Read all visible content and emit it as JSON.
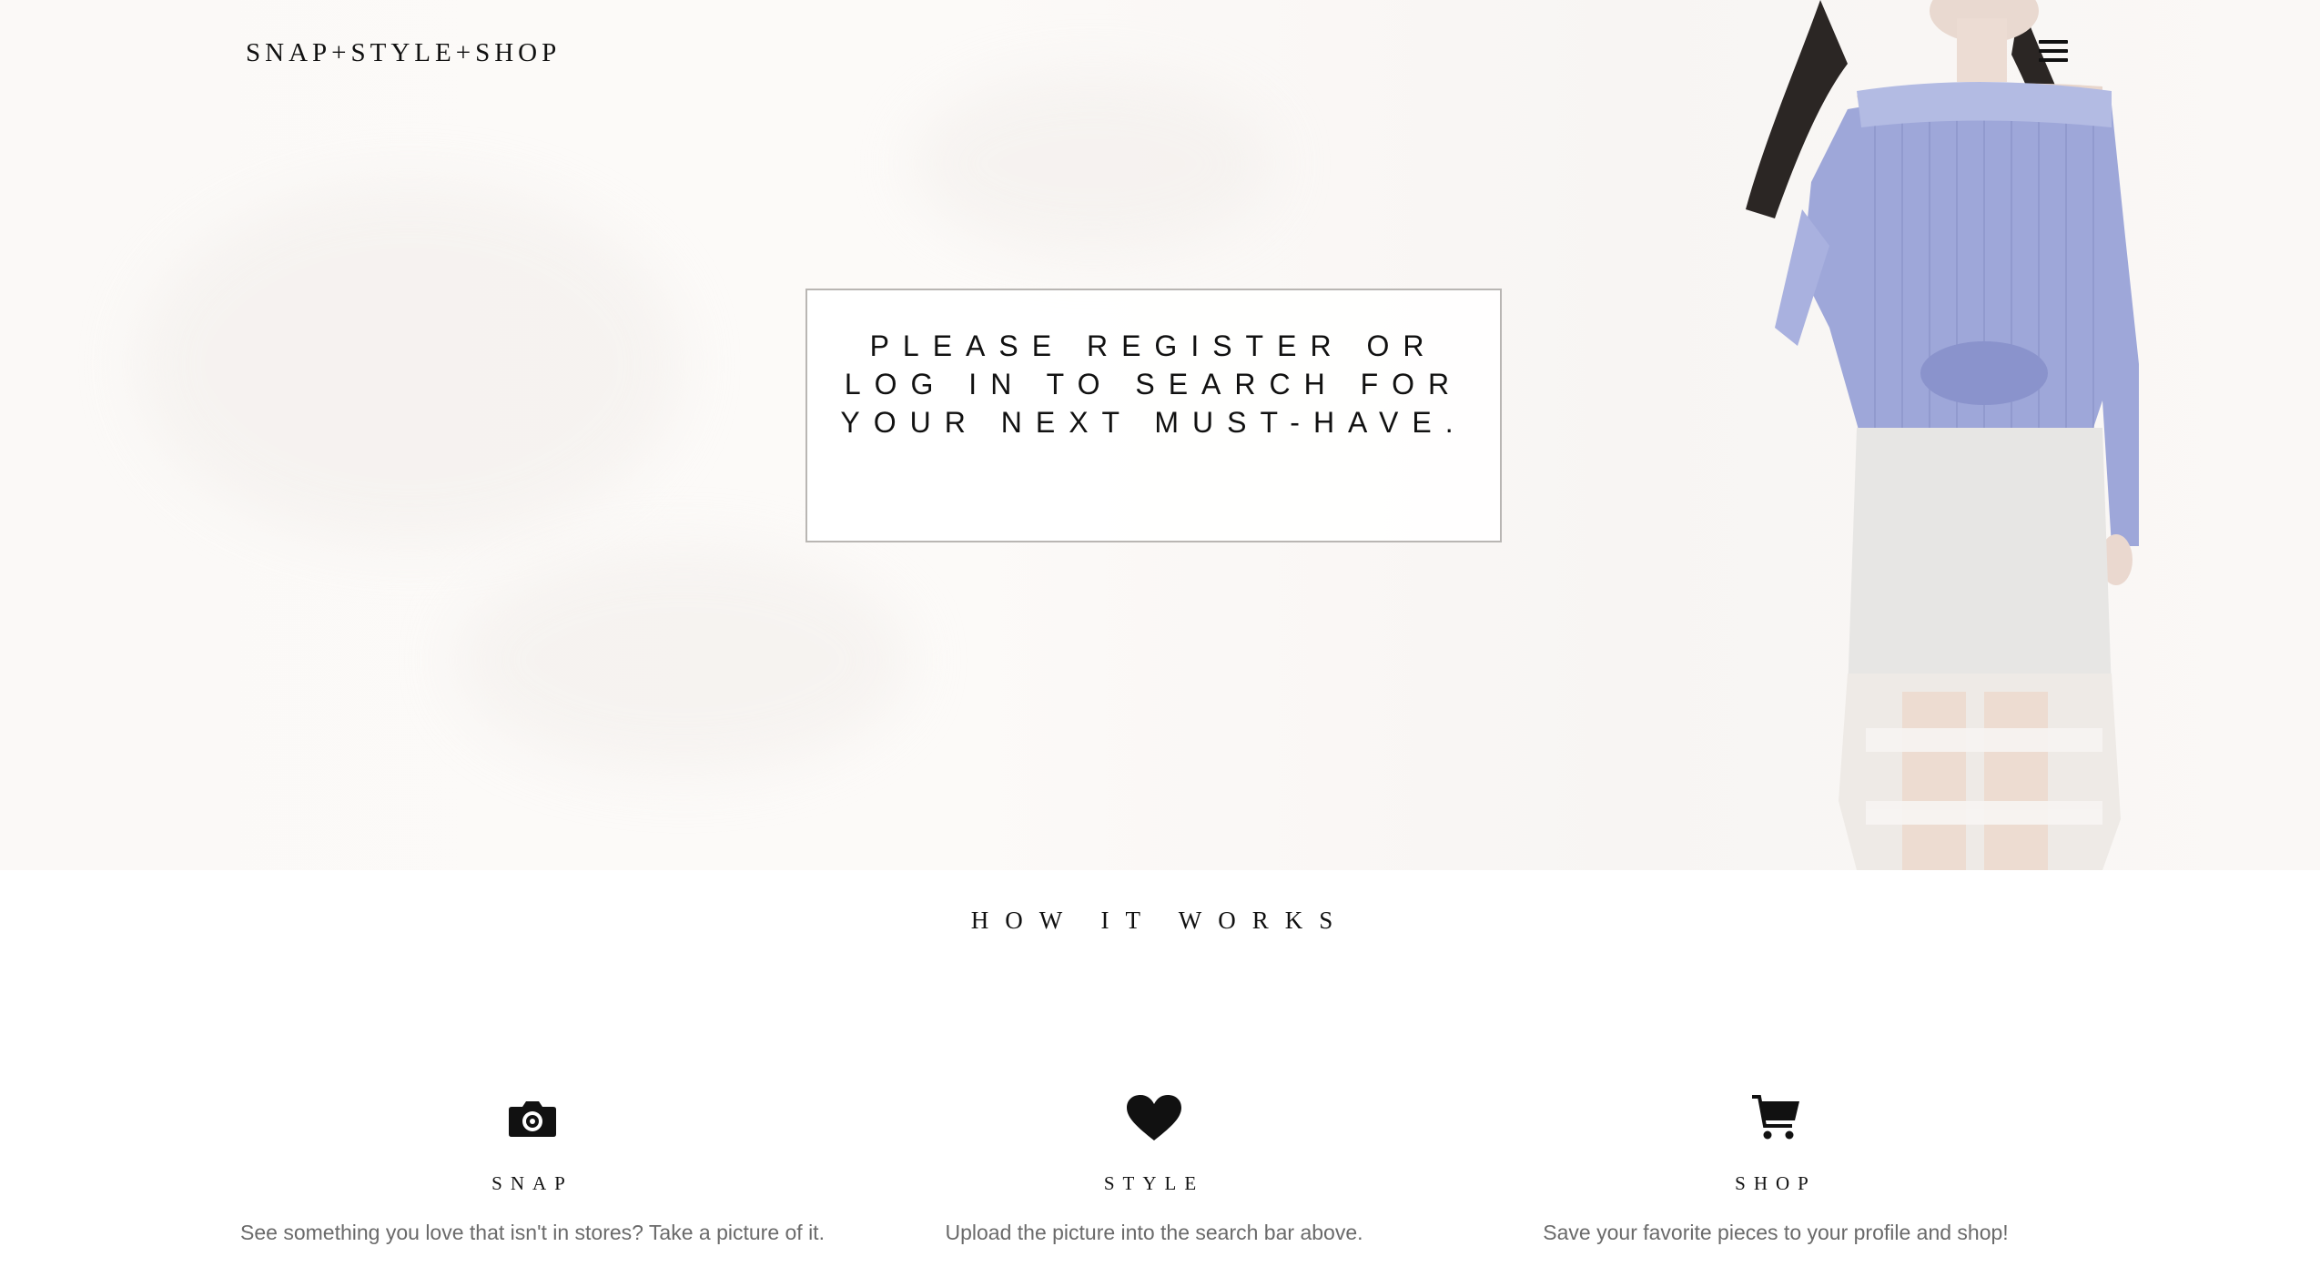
{
  "header": {
    "logo": "SNAP+STYLE+SHOP",
    "menu_icon": "hamburger-menu-icon"
  },
  "hero": {
    "login_prompt": "PLEASE REGISTER OR LOG IN TO SEARCH FOR YOUR NEXT MUST-HAVE."
  },
  "how_it_works": {
    "title": "HOW IT WORKS",
    "steps": [
      {
        "icon": "camera-icon",
        "title": "SNAP",
        "description": "See something you love that isn't in stores? Take a picture of it."
      },
      {
        "icon": "heart-icon",
        "title": "STYLE",
        "description": "Upload the picture into the search bar above."
      },
      {
        "icon": "cart-icon",
        "title": "SHOP",
        "description": "Save your favorite pieces to your profile and shop!"
      }
    ]
  },
  "colors": {
    "text": "#111111",
    "muted_text": "#6a6a6a",
    "box_border": "#b9b6b3",
    "hero_bg": "#fbf9f7",
    "shirt": "#9aa3d6"
  }
}
